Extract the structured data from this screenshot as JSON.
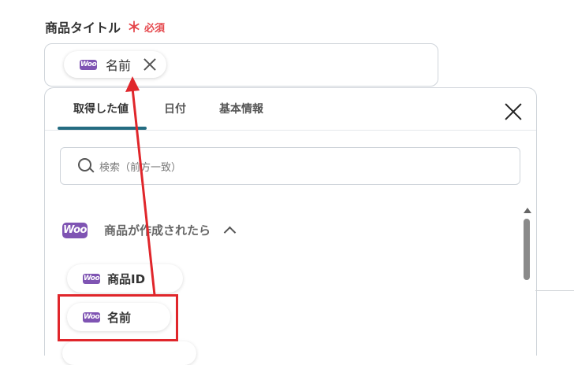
{
  "field": {
    "label": "商品タイトル",
    "required_star": "＊",
    "required_text": "必須",
    "chip": {
      "badge": "Woo",
      "text": "名前"
    }
  },
  "panel": {
    "tabs": [
      {
        "label": "取得した値",
        "active": true
      },
      {
        "label": "日付",
        "active": false
      },
      {
        "label": "基本情報",
        "active": false
      }
    ],
    "search": {
      "placeholder": "検索（前方一致）"
    },
    "group": {
      "badge": "Woo",
      "title": "商品が作成されたら"
    },
    "items": [
      {
        "badge": "Woo",
        "label": "商品ID"
      },
      {
        "badge": "Woo",
        "label": "名前"
      }
    ]
  },
  "colors": {
    "accent": "#246c81",
    "woo": "#7f54b3",
    "required": "#e5484d",
    "annotation": "#e0262b"
  }
}
